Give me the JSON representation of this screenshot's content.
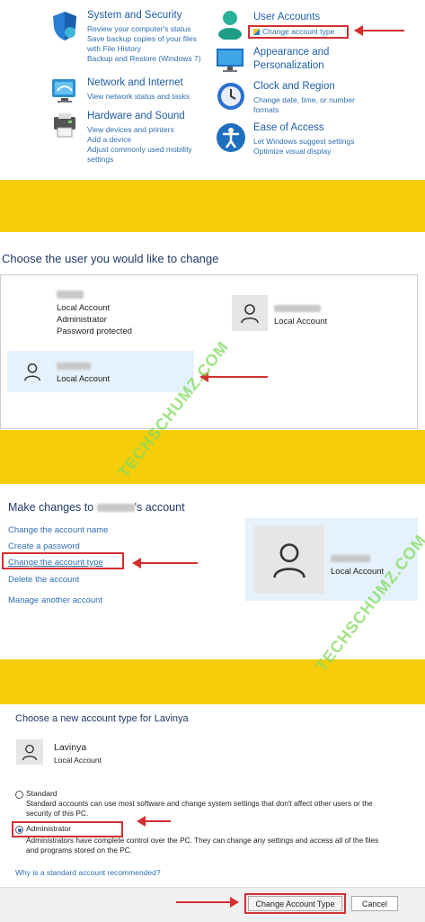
{
  "control_panel": {
    "categories": [
      {
        "title": "System and Security",
        "links": [
          "Review your computer's status",
          "Save backup copies of your files",
          "with File History",
          "Backup and Restore (Windows 7)"
        ],
        "icon": "shield-icon"
      },
      {
        "title": "Network and Internet",
        "links": [
          "View network status and tasks"
        ],
        "icon": "network-icon"
      },
      {
        "title": "Hardware and Sound",
        "links": [
          "View devices and printers",
          "Add a device",
          "Adjust commonly used mobility",
          "settings"
        ],
        "icon": "printer-icon"
      },
      {
        "title": "User Accounts",
        "links": [
          "Change account type"
        ],
        "icon": "users-icon"
      },
      {
        "title": "Appearance and Personalization",
        "title_lines": [
          "Appearance and",
          "Personalization"
        ],
        "links": [],
        "icon": "monitor-icon"
      },
      {
        "title": "Clock and Region",
        "links": [
          "Change date, time, or number",
          "formats"
        ],
        "icon": "clock-icon"
      },
      {
        "title": "Ease of Access",
        "links": [
          "Let Windows suggest settings",
          "Optimize visual display"
        ],
        "icon": "accessibility-icon"
      }
    ]
  },
  "choose_user": {
    "heading": "Choose the user you would like to change",
    "accounts": [
      {
        "lines": [
          "Local Account",
          "Administrator",
          "Password protected"
        ]
      },
      {
        "lines": [
          "Local Account"
        ]
      },
      {
        "lines": [
          "Local Account"
        ]
      }
    ]
  },
  "make_changes": {
    "heading_prefix": "Make changes to ",
    "heading_suffix": "'s account",
    "links": [
      "Change the account name",
      "Create a password",
      "Change the account type",
      "Delete the account",
      "Manage another account"
    ],
    "account_label": "Local Account"
  },
  "account_type": {
    "heading": "Choose a new account type for Lavinya",
    "user_name": "Lavinya",
    "user_type": "Local Account",
    "standard_label": "Standard",
    "standard_desc": [
      "Standard accounts can use most software and change system settings that don't affect other users or the",
      "security of this PC."
    ],
    "admin_label": "Administrator",
    "admin_desc": [
      "Administrators have complete control over the PC. They can change any settings and access all of the files",
      "and programs stored on the PC."
    ],
    "why_link": "Why is a standard account recommended?",
    "change_button": "Change Account Type",
    "cancel_button": "Cancel"
  },
  "watermark": "TECHSCHUMZ.COM",
  "colors": {
    "yellow": "#f6cd0b",
    "red": "#d32f2f",
    "link": "#2f6fb3",
    "watermark": "#7fdc5a"
  }
}
